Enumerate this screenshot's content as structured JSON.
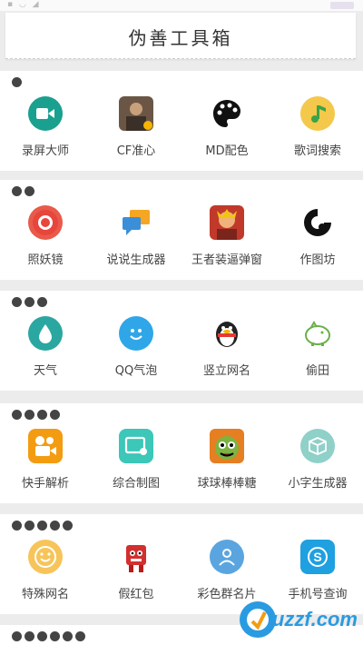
{
  "header": {
    "title": "伪善工具箱"
  },
  "sections": [
    {
      "dots": 1,
      "tools": [
        {
          "label": "录屏大师",
          "icon": "video-camera-icon"
        },
        {
          "label": "CF准心",
          "icon": "cf-game-icon"
        },
        {
          "label": "MD配色",
          "icon": "palette-icon"
        },
        {
          "label": "歌词搜索",
          "icon": "music-note-icon"
        }
      ]
    },
    {
      "dots": 2,
      "tools": [
        {
          "label": "照妖镜",
          "icon": "chrome-lens-icon"
        },
        {
          "label": "说说生成器",
          "icon": "speech-bubbles-icon"
        },
        {
          "label": "王者装逼弹窗",
          "icon": "king-glory-icon"
        },
        {
          "label": "作图坊",
          "icon": "swirl-icon"
        }
      ]
    },
    {
      "dots": 3,
      "tools": [
        {
          "label": "天气",
          "icon": "water-drop-icon"
        },
        {
          "label": "QQ气泡",
          "icon": "smile-bubble-icon"
        },
        {
          "label": "竖立网名",
          "icon": "penguin-icon"
        },
        {
          "label": "偷田",
          "icon": "piggy-icon"
        }
      ]
    },
    {
      "dots": 4,
      "tools": [
        {
          "label": "快手解析",
          "icon": "kuaishou-icon"
        },
        {
          "label": "综合制图",
          "icon": "image-tool-icon"
        },
        {
          "label": "球球棒棒糖",
          "icon": "ball-game-icon"
        },
        {
          "label": "小字生成器",
          "icon": "cube-icon"
        }
      ]
    },
    {
      "dots": 5,
      "tools": [
        {
          "label": "特殊网名",
          "icon": "smiley-icon"
        },
        {
          "label": "假红包",
          "icon": "red-robot-icon"
        },
        {
          "label": "彩色群名片",
          "icon": "user-card-icon"
        },
        {
          "label": "手机号查询",
          "icon": "skype-icon"
        }
      ]
    },
    {
      "dots": 6,
      "tools": []
    }
  ],
  "footer": {
    "logo_text": "uzzf.com"
  },
  "colors": {
    "accent": "#1ba39c",
    "background": "#ececec"
  }
}
